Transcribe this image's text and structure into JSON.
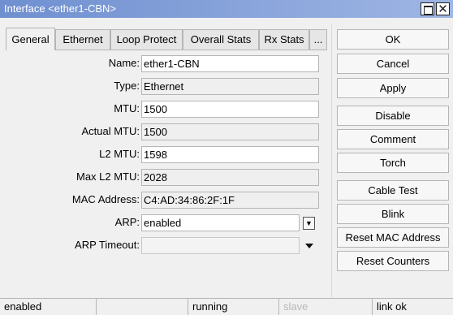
{
  "window": {
    "title": "Interface <ether1-CBN>"
  },
  "tabs": [
    {
      "label": "General",
      "active": true
    },
    {
      "label": "Ethernet"
    },
    {
      "label": "Loop Protect"
    },
    {
      "label": "Overall Stats"
    },
    {
      "label": "Rx Stats"
    },
    {
      "label": "..."
    }
  ],
  "form": {
    "name": {
      "label": "Name:",
      "value": "ether1-CBN"
    },
    "type": {
      "label": "Type:",
      "value": "Ethernet"
    },
    "mtu": {
      "label": "MTU:",
      "value": "1500"
    },
    "actual_mtu": {
      "label": "Actual MTU:",
      "value": "1500"
    },
    "l2_mtu": {
      "label": "L2 MTU:",
      "value": "1598"
    },
    "max_l2_mtu": {
      "label": "Max L2 MTU:",
      "value": "2028"
    },
    "mac_address": {
      "label": "MAC Address:",
      "value": "C4:AD:34:86:2F:1F"
    },
    "arp": {
      "label": "ARP:",
      "value": "enabled"
    },
    "arp_timeout": {
      "label": "ARP Timeout:",
      "value": ""
    }
  },
  "buttons": {
    "ok": "OK",
    "cancel": "Cancel",
    "apply": "Apply",
    "disable": "Disable",
    "comment": "Comment",
    "torch": "Torch",
    "cable_test": "Cable Test",
    "blink": "Blink",
    "reset_mac": "Reset MAC Address",
    "reset_counters": "Reset Counters"
  },
  "status": {
    "enabled": "enabled",
    "blank": "",
    "running": "running",
    "slave": "slave",
    "link": "link ok"
  },
  "icons": {
    "restore": "restore-icon",
    "close": "close-icon",
    "arp_dropdown": "dropdown-icon",
    "arp_timeout_dropdown": "chevron-down-icon"
  }
}
